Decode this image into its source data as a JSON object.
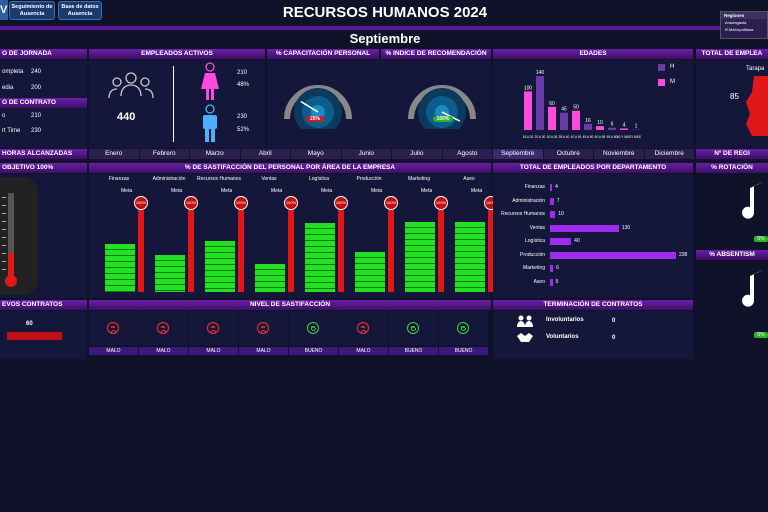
{
  "nav": {
    "btn1": "Seguimiento de Ausencia",
    "btn2": "Base de datos Ausencia",
    "left_logo": "V"
  },
  "title": "RECURSOS HUMANOS 2024",
  "month": "Septiembre",
  "regions": {
    "header": "Regiones",
    "items": [
      "Antofagasta",
      "R.Metropolitana"
    ]
  },
  "jornada": {
    "title": "O DE JORNADA",
    "rows": [
      {
        "label": "ompleta",
        "value": "240"
      },
      {
        "label": "edia",
        "value": "200"
      }
    ]
  },
  "contrato": {
    "title": "O DE CONTRATO",
    "rows": [
      {
        "label": "o",
        "value": "210"
      },
      {
        "label": "rt Time",
        "value": "230"
      }
    ]
  },
  "empleados": {
    "title": "EMPLEADOS ACTIVOS",
    "total": "440",
    "female_count": "210",
    "female_pct": "48%",
    "male_count": "230",
    "male_pct": "52%"
  },
  "capacitacion": {
    "title": "% CAPACITACIÓN PERSONAL",
    "value": "25%",
    "fraction": 0.25
  },
  "recomendacion": {
    "title": "% INDICE DE RECOMENDACIÓN",
    "value": "100%",
    "fraction": 1.0
  },
  "edades": {
    "title": "EDADES",
    "legend": [
      "H",
      "M"
    ],
    "colors": {
      "H": "#6a3aa8",
      "M": "#ff4ae0"
    },
    "bars": [
      {
        "label": "18 A 20",
        "value": 100,
        "s": "M"
      },
      {
        "label": "20 A 30",
        "value": 140,
        "s": "H"
      },
      {
        "label": "30 A 35",
        "value": 60,
        "s": "M"
      },
      {
        "label": "35 A 40",
        "value": 45,
        "s": "H"
      },
      {
        "label": "40 A 45",
        "value": 50,
        "s": "M"
      },
      {
        "label": "45 A 50",
        "value": 16,
        "s": "H"
      },
      {
        "label": "50 A 55",
        "value": 10,
        "s": "M"
      },
      {
        "label": "55 A 60",
        "value": 6,
        "s": "H"
      },
      {
        "label": "60 Y MÁS",
        "value": 4,
        "s": "M"
      },
      {
        "label": "Y MÁS",
        "value": 1,
        "s": "H"
      }
    ]
  },
  "total_empleados": {
    "title": "TOTAL DE EMPLEA",
    "region": "Tarapa",
    "value": "85"
  },
  "horas": {
    "title": "HORAS ALCANZADAS",
    "objetivo": "OBJETIVO  100%",
    "level": 0.3
  },
  "months": [
    "Enero",
    "Febrero",
    "Marzo",
    "Abril",
    "Mayo",
    "Junio",
    "Julio",
    "Agosto",
    "Septiembre",
    "Octubre",
    "Noviembre",
    "Diciembre"
  ],
  "satisfaccion": {
    "title": "%  DE SASTIFACCIÓN DEL PERSONAL POR ÁREA DE LA EMPRESA",
    "meta_label": "Meta",
    "meta_value": "100%",
    "areas": [
      {
        "name": "Finanzas",
        "level": 0.55
      },
      {
        "name": "Administración",
        "level": 0.42
      },
      {
        "name": "Recursos Humanos",
        "level": 0.58
      },
      {
        "name": "Ventas",
        "level": 0.32
      },
      {
        "name": "Logística",
        "level": 0.78
      },
      {
        "name": "Producción",
        "level": 0.45
      },
      {
        "name": "Marketing",
        "level": 0.8
      },
      {
        "name": "Aseo",
        "level": 0.8
      }
    ]
  },
  "dept": {
    "title": "TOTAL DE EMPLEADOS POR DEPARTAMENTO",
    "max": 238,
    "rows": [
      {
        "name": "Finanzas",
        "value": 4
      },
      {
        "name": "Administración",
        "value": 7
      },
      {
        "name": "Recursos Humanos",
        "value": 10
      },
      {
        "name": "Ventas",
        "value": 130
      },
      {
        "name": "Logística",
        "value": 40
      },
      {
        "name": "Producción",
        "value": 238
      },
      {
        "name": "Marketing",
        "value": 6
      },
      {
        "name": "Aseo",
        "value": 5
      }
    ]
  },
  "regiones_n": {
    "title": "Nº DE REGI"
  },
  "rotacion": {
    "title": "% ROTACIÓN",
    "value": "0%"
  },
  "ausentismo": {
    "title": "% ABSENTISM",
    "value": "0%"
  },
  "nuevos": {
    "title": "EVOS CONTRATOS",
    "value": "60"
  },
  "nivel": {
    "title": "NIVEL DE SASTIFACCIÓN",
    "faces": [
      "MALO",
      "MALO",
      "MALO",
      "MALO",
      "BUENO",
      "MALO",
      "BUENO",
      "BUENO"
    ]
  },
  "terminacion": {
    "title": "TERMINACIÓN DE CONTRATOS",
    "rows": [
      {
        "label": "Involuntarios",
        "value": "0"
      },
      {
        "label": "Voluntarios",
        "value": "0"
      }
    ]
  }
}
